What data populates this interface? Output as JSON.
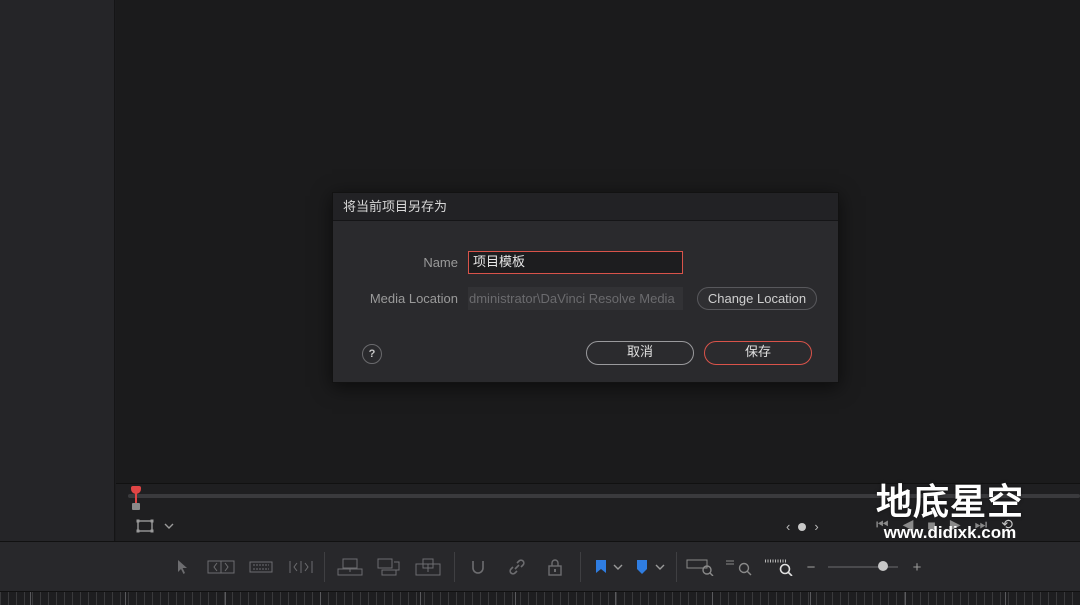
{
  "dialog": {
    "title": "将当前项目另存为",
    "name_label": "Name",
    "name_value": "项目模板",
    "media_location_label": "Media Location",
    "media_location_value": "dministrator\\DaVinci Resolve Media",
    "change_location_label": "Change Location",
    "help_label": "?",
    "cancel_label": "取消",
    "save_label": "保存"
  },
  "watermark": {
    "text": "地底星空",
    "url": "www.didixk.com"
  },
  "colors": {
    "accent": "#d9534a",
    "playhead": "#e04545",
    "flag_blue": "#2f7de1",
    "background": "#1c1c1e"
  },
  "toolbar": {
    "icons": [
      "selection-icon",
      "trim-icon",
      "blade-icon",
      "dynamic-trim-icon",
      "insert-icon",
      "overwrite-icon",
      "replace-icon",
      "snapping-icon",
      "link-icon",
      "lock-icon",
      "flag-icon",
      "marker-icon",
      "zoom-full-icon",
      "zoom-detail-icon",
      "zoom-custom-icon",
      "zoom-out-icon",
      "zoom-in-icon"
    ]
  }
}
